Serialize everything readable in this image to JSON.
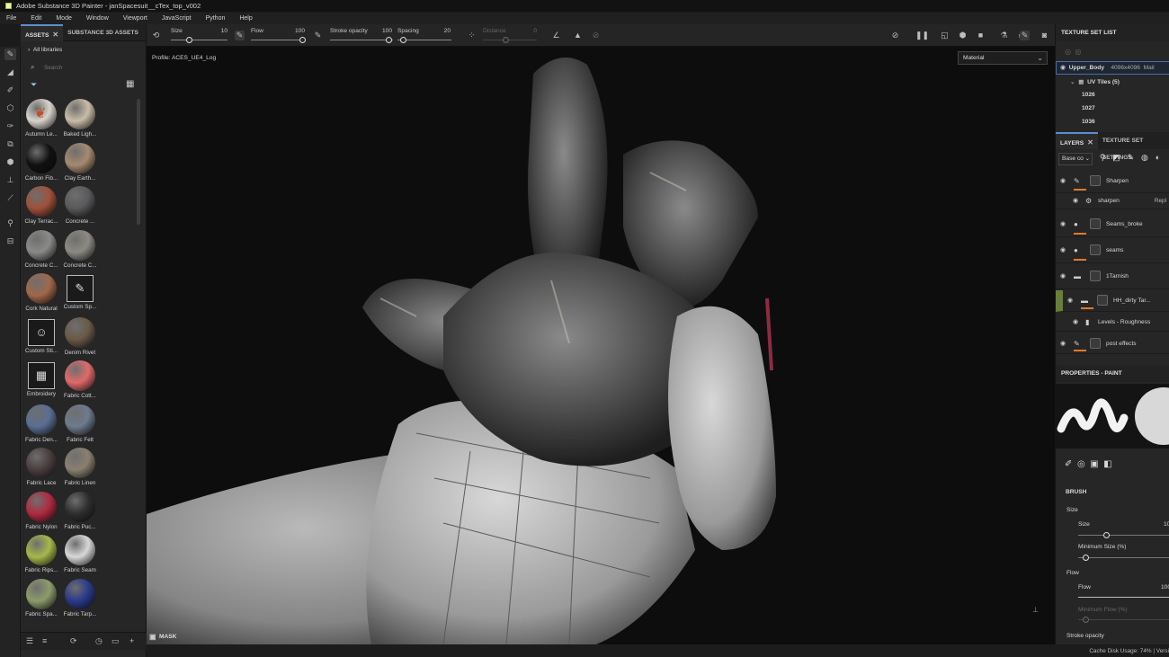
{
  "window": {
    "title": "Adobe Substance 3D Painter - janSpacesuit__cTex_top_v002"
  },
  "menu": [
    "File",
    "Edit",
    "Mode",
    "Window",
    "Viewport",
    "JavaScript",
    "Python",
    "Help"
  ],
  "toolbar": {
    "size_label": "Size",
    "size_value": "10",
    "flow_label": "Flow",
    "flow_value": "100",
    "stroke_label": "Stroke opacity",
    "stroke_value": "100",
    "spacing_label": "Spacing",
    "spacing_value": "20",
    "distance_label": "Distance",
    "distance_value": "0"
  },
  "assets": {
    "tab_assets": "ASSETS",
    "tab_substance": "SUBSTANCE 3D ASSETS",
    "library": "All libraries",
    "search_placeholder": "Search",
    "items": [
      {
        "name": "Autumn Le...",
        "color": "#d8d4cc",
        "kind": "leaf"
      },
      {
        "name": "Baked Ligh...",
        "color": "#c9bca7"
      },
      {
        "name": "Carbon Fib...",
        "color": "#111111"
      },
      {
        "name": "Clay Earth...",
        "color": "#a58a6f"
      },
      {
        "name": "Clay Terrac...",
        "color": "#a0503a"
      },
      {
        "name": "Concrete ...",
        "color": "#5a5a5c"
      },
      {
        "name": "Concrete C...",
        "color": "#8a8a88"
      },
      {
        "name": "Concrete C...",
        "color": "#8d8a82"
      },
      {
        "name": "Cork Natural",
        "color": "#a0684a"
      },
      {
        "name": "Custom Sp...",
        "color": "",
        "kind": "icon",
        "glyph": "✎"
      },
      {
        "name": "Custom Sti...",
        "color": "",
        "kind": "icon",
        "glyph": "☺"
      },
      {
        "name": "Denim Rivet",
        "color": "#6a5a48"
      },
      {
        "name": "Embroidery",
        "color": "",
        "kind": "icon",
        "glyph": "▦"
      },
      {
        "name": "Fabric Cott...",
        "color": "#e06a6a"
      },
      {
        "name": "Fabric Den...",
        "color": "#5a6e92"
      },
      {
        "name": "Fabric Felt",
        "color": "#6e7a8e"
      },
      {
        "name": "Fabric Lace",
        "color": "#4a3e3e"
      },
      {
        "name": "Fabric Linen",
        "color": "#8a8070"
      },
      {
        "name": "Fabric Nylon",
        "color": "#b02a40"
      },
      {
        "name": "Fabric Puc...",
        "color": "#2e2e2e"
      },
      {
        "name": "Fabric Rips...",
        "color": "#a6b84a"
      },
      {
        "name": "Fabric Seam",
        "color": "#d8d8d8"
      },
      {
        "name": "Fabric Spa...",
        "color": "#8c9c6a"
      },
      {
        "name": "Fabric Tarp...",
        "color": "#2a3a8a"
      }
    ]
  },
  "viewport": {
    "profile": "Profile: ACES_UE4_Log",
    "material_select": "Material",
    "mask_label": "MASK"
  },
  "texture_set": {
    "header": "TEXTURE SET LIST",
    "set_name": "Upper_Body",
    "set_res": "4096x4096",
    "set_extra": "Mail",
    "uv_tiles": "UV Tiles (5)",
    "tiles": [
      "1026",
      "1027",
      "1036"
    ]
  },
  "layers": {
    "tab_layers": "LAYERS",
    "tab_settings": "TEXTURE SET SETTINGS",
    "channel": "Base co",
    "items": [
      {
        "name": "Sharpen",
        "kind": "paint"
      },
      {
        "name": "sharpen",
        "kind": "filter",
        "extra": "Repl"
      },
      {
        "name": "Seams_broke",
        "kind": "fill"
      },
      {
        "name": "seams",
        "kind": "fill"
      },
      {
        "name": "1Tarnish",
        "kind": "folder"
      },
      {
        "name": "HH_dirty Tar...",
        "kind": "folder"
      },
      {
        "name": "Levels - Roughness",
        "kind": "levels"
      },
      {
        "name": "post effects",
        "kind": "paint"
      }
    ]
  },
  "properties": {
    "header": "PROPERTIES - PAINT",
    "brush": "BRUSH",
    "size_section": "Size",
    "size_label": "Size",
    "size_value": "10",
    "min_size_label": "Minimum Size (%)",
    "flow_section": "Flow",
    "flow_label": "Flow",
    "flow_value": "100",
    "min_flow_label": "Minimum Flow (%)",
    "stroke_label": "Stroke opacity"
  },
  "status": {
    "text": "Cache Disk Usage:   74% | Versi"
  }
}
